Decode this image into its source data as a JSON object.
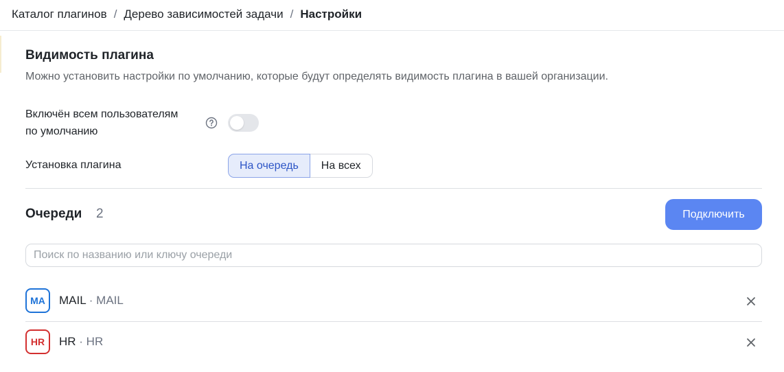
{
  "breadcrumbs": [
    "Каталог плагинов",
    "Дерево зависимостей задачи",
    "Настройки"
  ],
  "breadcrumb_separator": "/",
  "visibility": {
    "title": "Видимость плагина",
    "description": "Можно установить настройки по умолчанию, которые будут определять видимость плагина в вашей организации.",
    "default_enabled_label_1": "Включён всем пользователям",
    "default_enabled_label_2": "по умолчанию",
    "default_enabled_on": false,
    "help_icon": "question-circle-icon"
  },
  "install": {
    "label": "Установка плагина",
    "options": [
      "На очередь",
      "На всех"
    ],
    "selected": "На очередь"
  },
  "queues": {
    "title": "Очереди",
    "count": "2",
    "connect_label": "Подключить",
    "search_placeholder": "Поиск по названию или ключу очереди",
    "items": [
      {
        "badge": "MA",
        "name": "MAIL",
        "key": "· MAIL",
        "color": "#1e73d8"
      },
      {
        "badge": "HR",
        "name": "HR",
        "key": "· HR",
        "color": "#d32f2f"
      }
    ]
  },
  "colors": {
    "accent": "#5b86f2",
    "segment_active_bg": "#e6ecfb"
  }
}
